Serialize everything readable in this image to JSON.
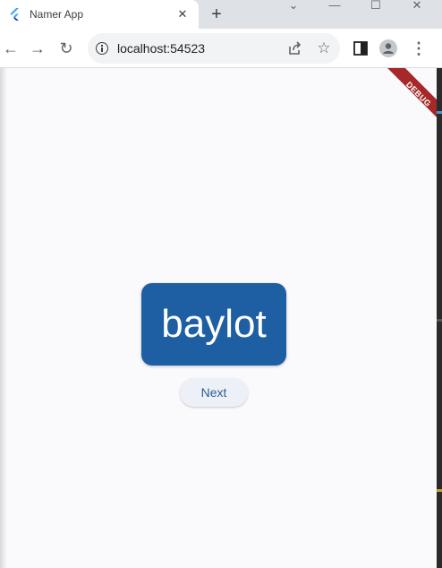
{
  "browser": {
    "tab_title": "Namer App",
    "url": "localhost:54523",
    "icons": {
      "favicon": "flutter-icon",
      "tab_close": "close-icon",
      "new_tab": "plus-icon",
      "back": "back-arrow-icon",
      "forward": "forward-arrow-icon",
      "reload": "reload-icon",
      "site_info": "info-icon",
      "share": "share-icon",
      "bookmark": "star-icon",
      "side_panel": "side-panel-icon",
      "profile": "profile-icon",
      "menu": "kebab-menu-icon"
    }
  },
  "app": {
    "word": "baylot",
    "next_label": "Next",
    "debug_label": "DEBUG"
  },
  "colors": {
    "card": "#1e5fa3",
    "button_text": "#2b5d93",
    "debug_banner": "#a62828",
    "page_bg": "#fafafd"
  }
}
